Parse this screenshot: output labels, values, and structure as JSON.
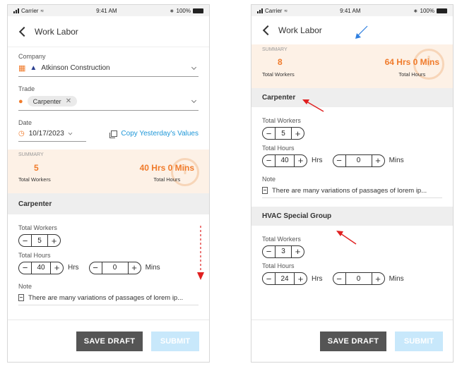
{
  "status": {
    "carrier": "Carrier",
    "time": "9:41 AM",
    "battery": "100%"
  },
  "header": {
    "title": "Work Labor"
  },
  "company": {
    "label": "Company",
    "value": "Atkinson Construction"
  },
  "trade": {
    "label": "Trade",
    "chip": "Carpenter"
  },
  "date": {
    "label": "Date",
    "value": "10/17/2023",
    "copy_link": "Copy Yesterday's Values"
  },
  "screen1_summary": {
    "title": "SUMMARY",
    "workers": "5",
    "workers_caption": "Total Workers",
    "hours": "40 Hrs 0 Mins",
    "hours_caption": "Total Hours"
  },
  "screen2_summary": {
    "title": "SUMMARY",
    "workers": "8",
    "workers_caption": "Total Workers",
    "hours": "64 Hrs 0 Mins",
    "hours_caption": "Total Hours"
  },
  "labels": {
    "total_workers": "Total Workers",
    "total_hours": "Total Hours",
    "hrs": "Hrs",
    "mins": "Mins",
    "note": "Note"
  },
  "groups": [
    {
      "name": "Carpenter",
      "workers": "5",
      "hours": "40",
      "mins": "0",
      "note": "There are many variations of passages of lorem ip..."
    },
    {
      "name": "HVAC Special Group",
      "workers": "3",
      "hours": "24",
      "mins": "0"
    }
  ],
  "footer": {
    "save_draft": "SAVE DRAFT",
    "submit": "SUBMIT"
  },
  "colors": {
    "accent": "#f07b2b",
    "link": "#1e97d8",
    "annotation_red": "#e02020",
    "annotation_blue": "#2f7fe0"
  }
}
